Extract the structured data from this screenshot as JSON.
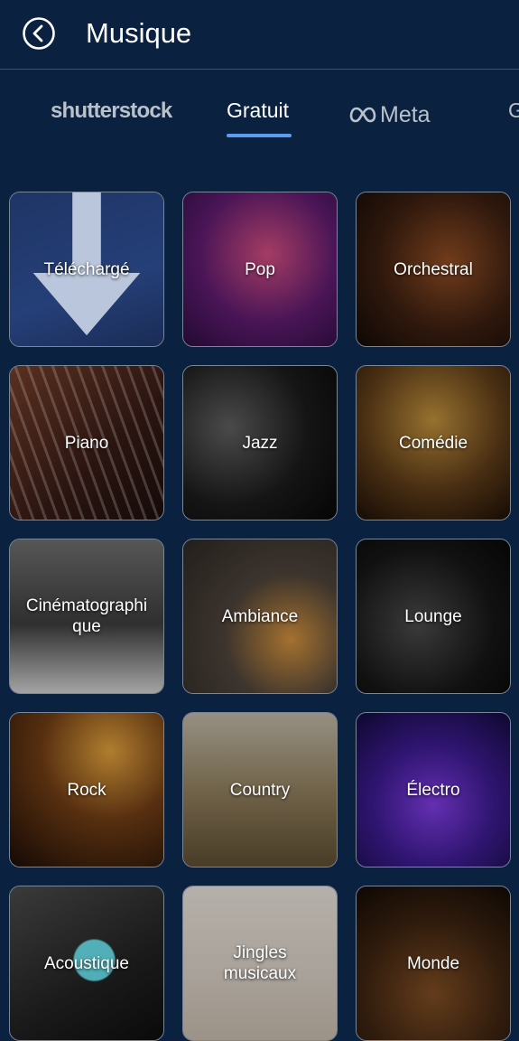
{
  "header": {
    "title": "Musique",
    "back_icon": "chevron-left-circle-icon"
  },
  "tabs": [
    {
      "label": "shutterstock"
    },
    {
      "label": "Gratuit",
      "selected": true
    },
    {
      "label": "Meta",
      "icon": "meta-infinity-icon"
    },
    {
      "label": "G"
    }
  ],
  "colors": {
    "background": "#0a2140",
    "accent": "#5b9cf0",
    "divider": "#3b5270"
  },
  "categories": [
    {
      "label": "Téléchargé"
    },
    {
      "label": "Pop"
    },
    {
      "label": "Orchestral"
    },
    {
      "label": "Piano"
    },
    {
      "label": "Jazz"
    },
    {
      "label": "Comédie"
    },
    {
      "label": "Cinématographi\nque"
    },
    {
      "label": "Ambiance"
    },
    {
      "label": "Lounge"
    },
    {
      "label": "Rock"
    },
    {
      "label": "Country"
    },
    {
      "label": "Électro"
    },
    {
      "label": "Acoustique"
    },
    {
      "label": "Jingles\nmusicaux"
    },
    {
      "label": "Monde"
    }
  ]
}
